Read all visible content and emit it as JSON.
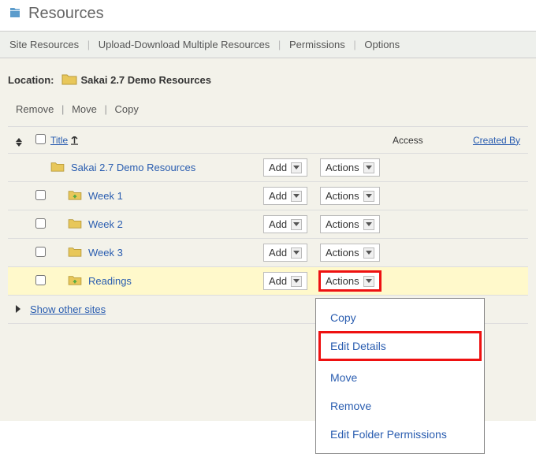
{
  "page": {
    "title": "Resources"
  },
  "toolbar": {
    "site_resources": "Site Resources",
    "upload_download": "Upload-Download Multiple Resources",
    "permissions": "Permissions",
    "options": "Options"
  },
  "location": {
    "label": "Location:",
    "path": "Sakai 2.7 Demo Resources"
  },
  "actions": {
    "remove": "Remove",
    "move": "Move",
    "copy": "Copy"
  },
  "columns": {
    "title": "Title",
    "access": "Access",
    "created_by": "Created By"
  },
  "buttons": {
    "add": "Add",
    "actions": "Actions"
  },
  "items": [
    {
      "name": "Sakai 2.7 Demo Resources",
      "indent": 0,
      "plus": false,
      "checkbox": false
    },
    {
      "name": "Week 1",
      "indent": 1,
      "plus": true,
      "checkbox": true
    },
    {
      "name": "Week 2",
      "indent": 1,
      "plus": false,
      "checkbox": true
    },
    {
      "name": "Week 3",
      "indent": 1,
      "plus": false,
      "checkbox": true
    },
    {
      "name": "Readings",
      "indent": 1,
      "plus": true,
      "checkbox": true,
      "highlighted": true,
      "actions_red": true
    }
  ],
  "show_other": "Show other sites",
  "dropdown": {
    "copy": "Copy",
    "edit_details": "Edit Details",
    "move": "Move",
    "remove": "Remove",
    "edit_permissions": "Edit Folder Permissions"
  }
}
